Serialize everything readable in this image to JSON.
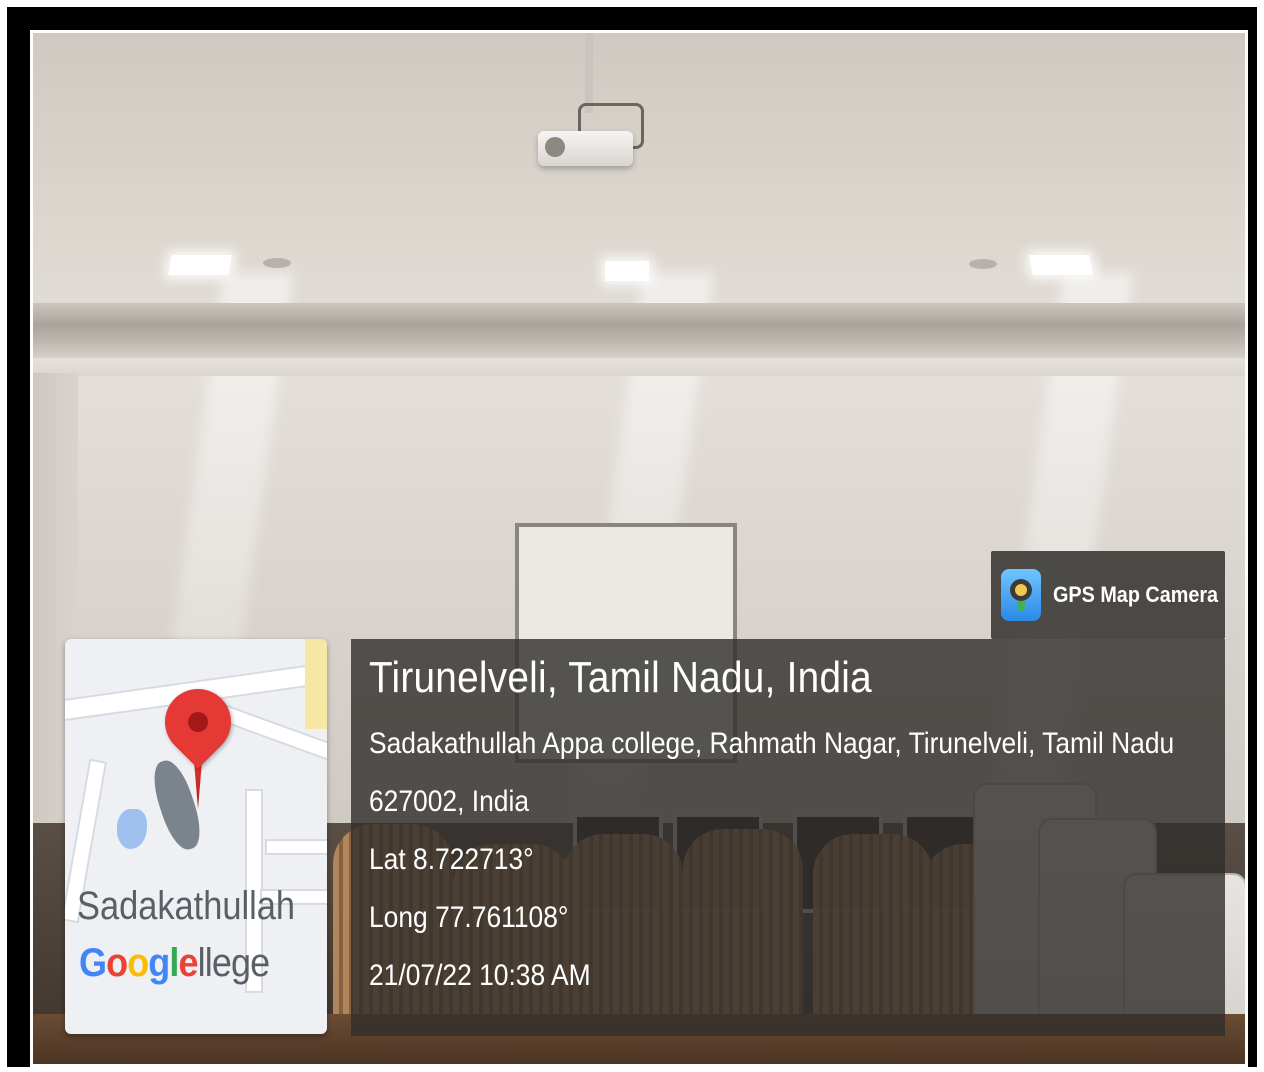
{
  "overlay": {
    "app_name": "GPS Map Camera",
    "title": "Tirunelveli, Tamil Nadu, India",
    "address_line1": "Sadakathullah Appa college, Rahmath Nagar, Tirunelveli, Tamil Nadu",
    "address_line2": "627002, India",
    "lat": "Lat 8.722713°",
    "long": "Long 77.761108°",
    "datetime": "21/07/22 10:38 AM"
  },
  "map": {
    "place_label": "Sadakathullah",
    "google_logo": "Google",
    "place_label_tail": "llege",
    "pin_color": "#e53935"
  },
  "icons": [
    "gps-map-camera-icon",
    "map-pin-icon"
  ]
}
